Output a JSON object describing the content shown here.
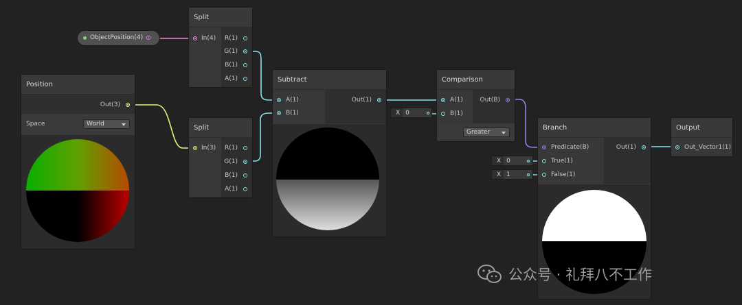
{
  "canvas": {
    "background": "#222222"
  },
  "colors": {
    "cyan_port": "#84e4e7",
    "yellow_port": "#e9f07a",
    "pink_port": "#e78fd6",
    "purple_port": "#9481e6"
  },
  "property_node": {
    "label": "ObjectPosition(4)"
  },
  "split_top": {
    "title": "Split",
    "input": "In(4)",
    "outputs": [
      "R(1)",
      "G(1)",
      "B(1)",
      "A(1)"
    ]
  },
  "position": {
    "title": "Position",
    "output": "Out(3)",
    "space_label": "Space",
    "space_value": "World"
  },
  "split_bottom": {
    "title": "Split",
    "input": "In(3)",
    "outputs": [
      "R(1)",
      "G(1)",
      "B(1)",
      "A(1)"
    ]
  },
  "subtract": {
    "title": "Subtract",
    "inputs": [
      "A(1)",
      "B(1)"
    ],
    "output": "Out(1)"
  },
  "comparison": {
    "title": "Comparison",
    "inputs": [
      "A(1)",
      "B(1)"
    ],
    "output": "Out(B)",
    "b_axis": "X",
    "b_value": "0",
    "mode": "Greater"
  },
  "branch": {
    "title": "Branch",
    "inputs": [
      "Predicate(B)",
      "True(1)",
      "False(1)"
    ],
    "output": "Out(1)",
    "true_axis": "X",
    "true_value": "0",
    "false_axis": "X",
    "false_value": "1"
  },
  "output_node": {
    "title": "Output",
    "input": "Out_Vector1(1)"
  },
  "watermark": {
    "icon": "wechat-icon",
    "text": "公众号 · 礼拜八不工作"
  }
}
